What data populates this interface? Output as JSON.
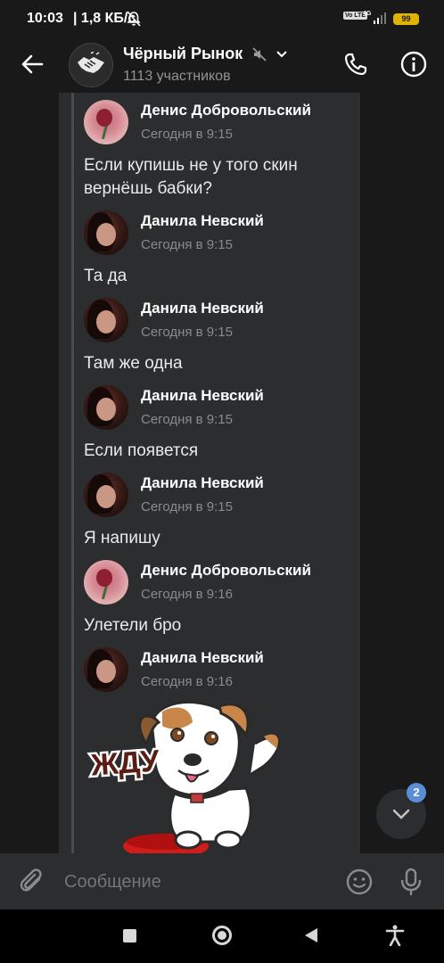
{
  "status_bar": {
    "time": "10:03",
    "speed": "| 1,8 КБ/с",
    "network": "4G",
    "volte": "Vo LTE",
    "battery": "99"
  },
  "header": {
    "title": "Чёрный Рынок",
    "subtitle": "1113 участников"
  },
  "messages": [
    {
      "author": "Денис Добровольский",
      "time": "Сегодня в 9:15",
      "text": "Если купишь не у того скин вернёшь бабки?",
      "avatar": "denis"
    },
    {
      "author": "Данила Невский",
      "time": "Сегодня в 9:15",
      "text": "Та да",
      "avatar": "danila"
    },
    {
      "author": "Данила Невский",
      "time": "Сегодня в 9:15",
      "text": "Там же одна",
      "avatar": "danila"
    },
    {
      "author": "Данила Невский",
      "time": "Сегодня в 9:15",
      "text": "Если появется",
      "avatar": "danila"
    },
    {
      "author": "Данила Невский",
      "time": "Сегодня в 9:15",
      "text": "Я напишу",
      "avatar": "danila"
    },
    {
      "author": "Денис Добровольский",
      "time": "Сегодня в 9:16",
      "text": "Улетели бро",
      "avatar": "denis"
    },
    {
      "author": "Данила Невский",
      "time": "Сегодня в 9:16",
      "text": "",
      "avatar": "danila"
    }
  ],
  "sticker": {
    "caption": "ЖДУ"
  },
  "scroll_down": {
    "unread_count": "2"
  },
  "composer": {
    "placeholder": "Сообщение"
  },
  "colors": {
    "background": "#191919",
    "forward_box": "#2c2d2e",
    "badge": "#5a8fd8",
    "battery": "#e0b300"
  }
}
